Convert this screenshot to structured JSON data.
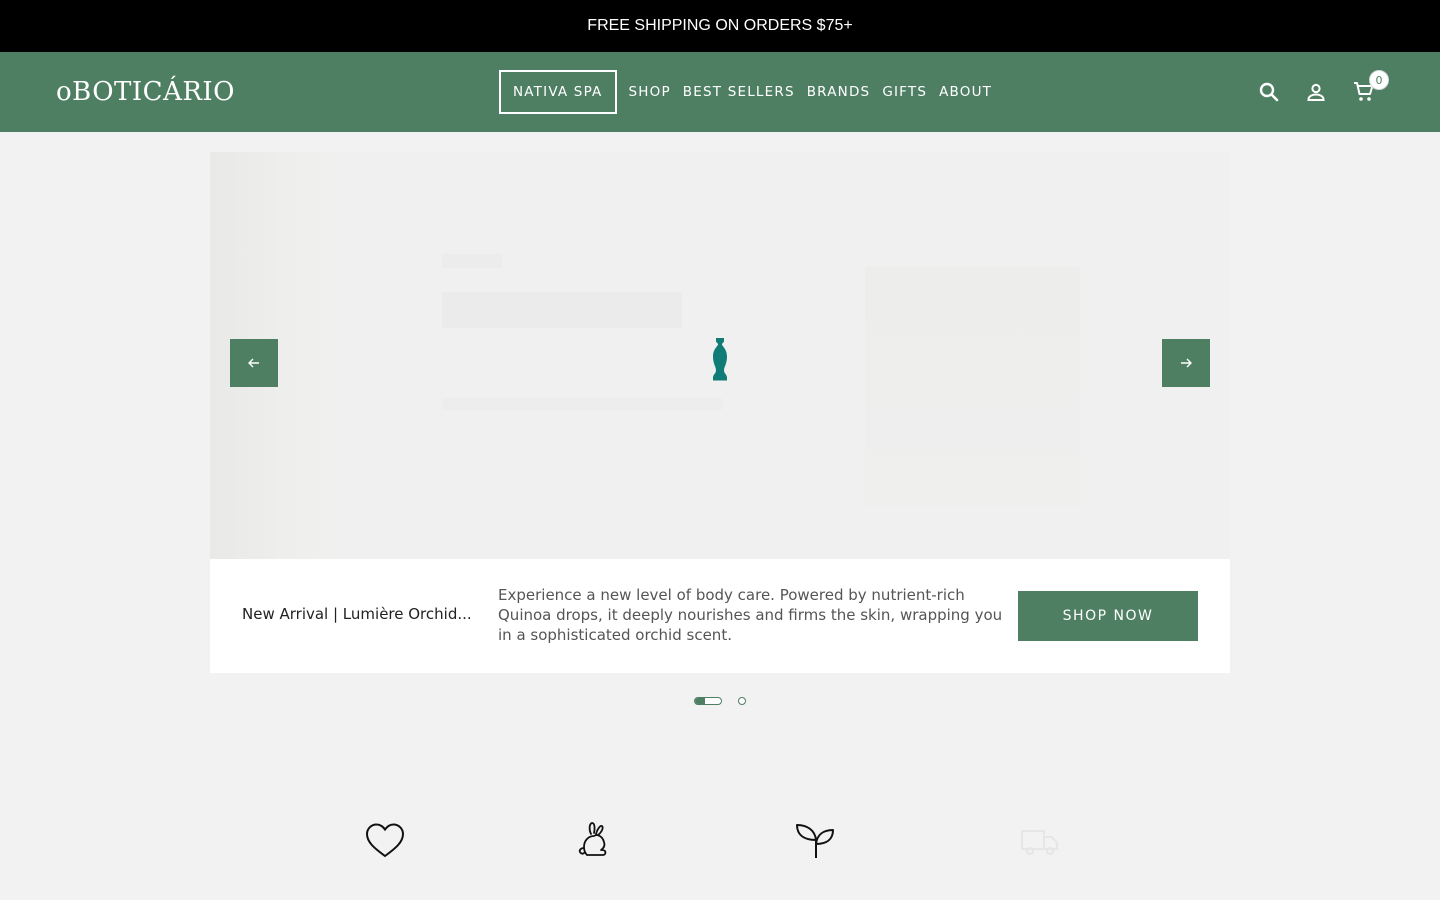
{
  "announcement": {
    "text": "FREE SHIPPING ON ORDERS $75+"
  },
  "header": {
    "logo_text": "oBOTICÁRIO",
    "nav": [
      {
        "label": "NATIVA SPA",
        "active": true
      },
      {
        "label": "SHOP"
      },
      {
        "label": "BEST SELLERS"
      },
      {
        "label": "BRANDS"
      },
      {
        "label": "GIFTS"
      },
      {
        "label": "ABOUT"
      }
    ],
    "icons": [
      "search-icon",
      "account-icon",
      "cart-icon"
    ],
    "cart_count": "0"
  },
  "hero": {
    "slide_title": "New Arrival | Lumière Orchid...",
    "slide_description": "Experience a new level of body care. Powered by nutrient-rich Quinoa drops, it deeply nourishes and firms the skin, wrapping you in a sophisticated orchid scent.",
    "cta_label": "SHOP NOW",
    "prev_icon": "arrow-left-icon",
    "next_icon": "arrow-right-icon",
    "slide_count": 2,
    "active_slide": 1
  },
  "features": {
    "icons": [
      "heart-icon",
      "rabbit-icon",
      "sprout-icon",
      "truck-icon"
    ]
  },
  "colors": {
    "brand_green": "#4f7f63",
    "announcement_bg": "#000000",
    "page_bg": "#f2f2f2",
    "vase_teal": "#0f7c77"
  }
}
